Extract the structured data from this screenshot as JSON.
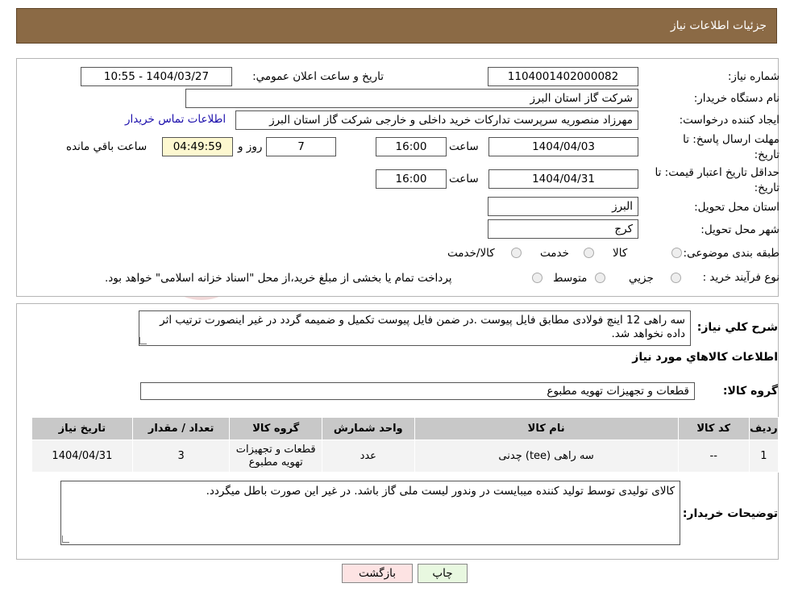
{
  "header": {
    "title": "جزئیات اطلاعات نیاز"
  },
  "form": {
    "need_number_label": "شماره نیاز:",
    "need_number": "1104001402000082",
    "announce_label": "تاریخ و ساعت اعلان عمومي:",
    "announce_value": "1404/03/27 - 10:55",
    "buyer_org_label": "نام دستگاه خريدار:",
    "buyer_org": "شرکت گاز استان البرز",
    "creator_label": "ايجاد کننده درخواست:",
    "creator": "مهرزاد منصوریه سرپرست تدارکات خرید داخلی و خارجی شرکت گاز استان البرز",
    "contact_link": "اطلاعات تماس خريدار",
    "reply_deadline_label": "مهلت ارسال پاسخ: تا تاريخ:",
    "reply_date": "1404/04/03",
    "time_label": "ساعت",
    "reply_time": "16:00",
    "days_value": "7",
    "days_label": "روز و",
    "remaining_time": "04:49:59",
    "remaining_label": "ساعت باقي مانده",
    "price_validity_label": "حداقل تاريخ اعتبار قيمت: تا تاريخ:",
    "price_date": "1404/04/31",
    "price_time": "16:00",
    "province_label": "استان محل تحويل:",
    "province": "البرز",
    "city_label": "شهر محل تحويل:",
    "city": "کرج",
    "category_label": "طبقه بندی موضوعی:",
    "category_options": [
      "کالا",
      "خدمت",
      "کالا/خدمت"
    ],
    "process_label": "نوع فرآيند خريد :",
    "process_options": [
      "جزيي",
      "متوسط"
    ],
    "process_note": "پرداخت تمام یا بخشی از مبلغ خرید،از محل \"اسناد خزانه اسلامی\" خواهد بود."
  },
  "summary": {
    "label": "شرح كلي نياز:",
    "text": "سه راهی 12 اینچ فولادی مطابق فایل پیوست .در ضمن فایل پیوست تکمیل و ضمیمه گردد در غیر اینصورت ترتیب اثر داده نخواهد شد."
  },
  "goods_section_title": "اطلاعات کالاهاي مورد نياز",
  "goods_group": {
    "label": "گروه کالا:",
    "value": "قطعات و تجهیزات تهویه مطبوع"
  },
  "table": {
    "headers": [
      "رديف",
      "کد کالا",
      "نام کالا",
      "واحد شمارش",
      "گروه کالا",
      "تعداد / مقدار",
      "تاريخ نياز"
    ],
    "rows": [
      [
        "1",
        "--",
        "سه راهی (tee) چدنی",
        "عدد",
        "قطعات و تجهیزات تهویه مطبوع",
        "3",
        "1404/04/31"
      ]
    ]
  },
  "buyer_notes": {
    "label": "توضيحات خريدار:",
    "text": "کالای تولیدی توسط تولید کننده میبایست در وندور لیست ملی گاز باشد. در غیر این صورت باطل میگردد."
  },
  "buttons": {
    "print": "چاپ",
    "back": "بازگشت"
  },
  "colors": {
    "header": "#8b6a45",
    "print_btn": "#e8f8e0",
    "back_btn": "#fde3e3"
  }
}
